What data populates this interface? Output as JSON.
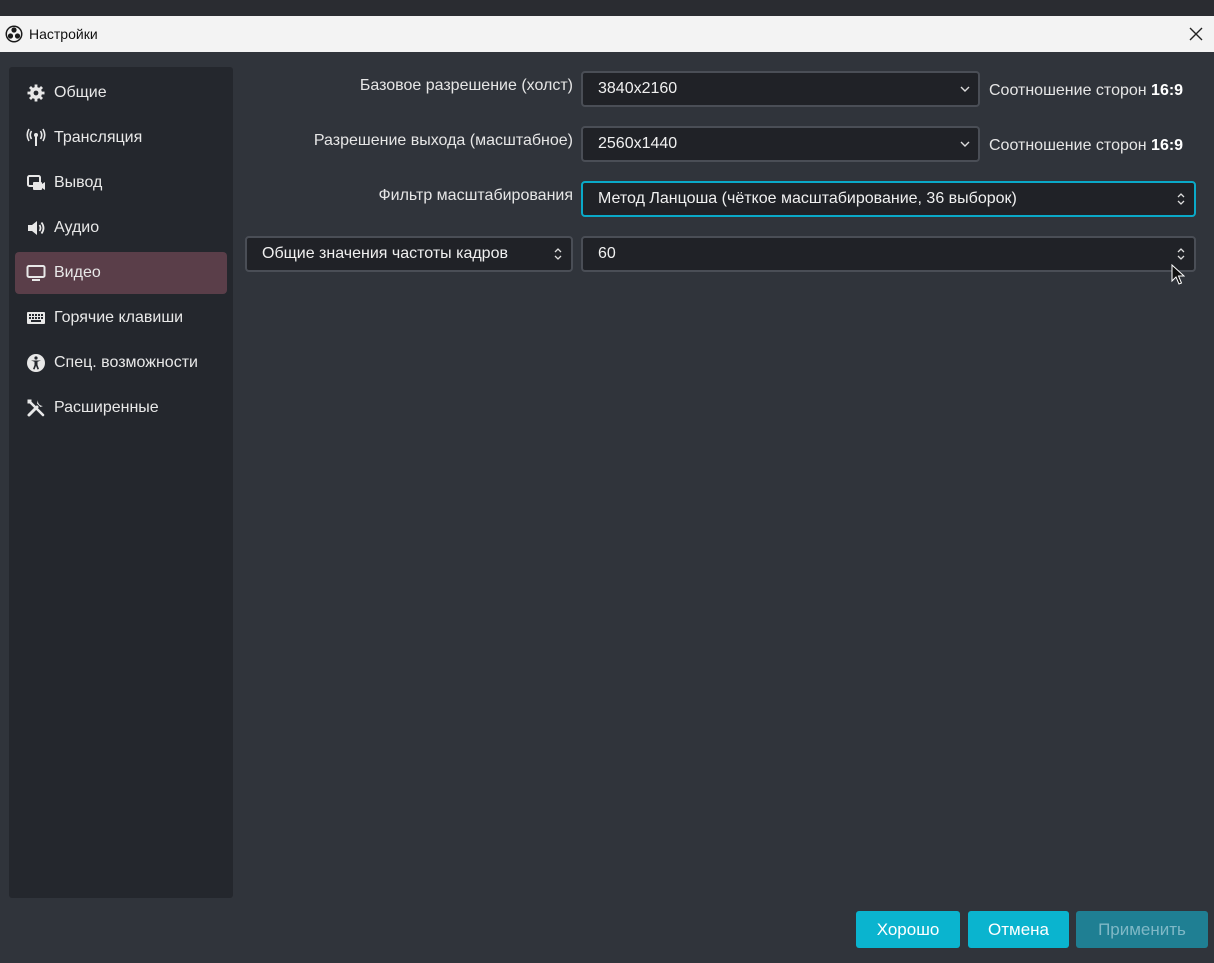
{
  "window": {
    "title": "Настройки"
  },
  "sidebar": {
    "items": [
      {
        "label": "Общие",
        "icon": "gear-icon"
      },
      {
        "label": "Трансляция",
        "icon": "antenna-icon"
      },
      {
        "label": "Вывод",
        "icon": "output-icon"
      },
      {
        "label": "Аудио",
        "icon": "speaker-icon"
      },
      {
        "label": "Видео",
        "icon": "monitor-icon",
        "active": true
      },
      {
        "label": "Горячие клавиши",
        "icon": "keyboard-icon"
      },
      {
        "label": "Спец. возможности",
        "icon": "accessibility-icon"
      },
      {
        "label": "Расширенные",
        "icon": "tools-icon"
      }
    ]
  },
  "video": {
    "base_resolution": {
      "label": "Базовое разрешение (холст)",
      "value": "3840x2160",
      "aspect_prefix": "Соотношение сторон",
      "aspect_value": "16:9"
    },
    "output_resolution": {
      "label": "Разрешение выхода (масштабное)",
      "value": "2560x1440",
      "aspect_prefix": "Соотношение сторон",
      "aspect_value": "16:9"
    },
    "scale_filter": {
      "label": "Фильтр масштабирования",
      "value": "Метод Ланцоша (чёткое масштабирование, 36 выборок)"
    },
    "fps": {
      "type_value": "Общие значения частоты кадров",
      "value": "60"
    }
  },
  "buttons": {
    "ok": "Хорошо",
    "cancel": "Отмена",
    "apply": "Применить"
  },
  "colors": {
    "accent": "#0ab4cf",
    "active_nav": "#5a3e49",
    "focus_border": "#0aa9c8"
  }
}
